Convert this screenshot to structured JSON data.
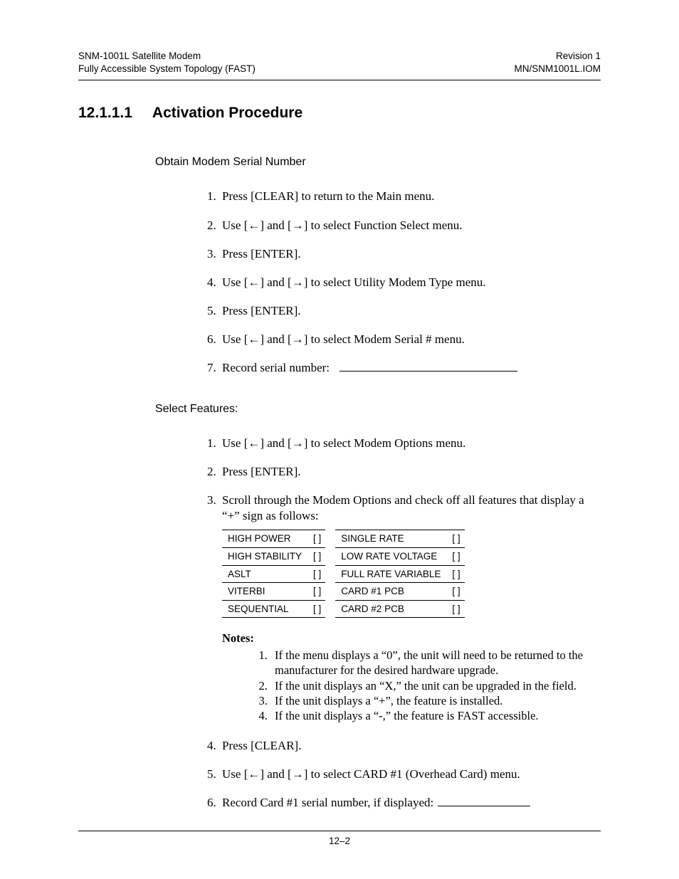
{
  "header": {
    "leftLine1": "SNM-1001L  Satellite Modem",
    "leftLine2": "Fully Accessible System Topology (FAST)",
    "rightLine1": "Revision 1",
    "rightLine2": "MN/SNM1001L.IOM"
  },
  "section": {
    "number": "12.1.1.1",
    "title": "Activation Procedure"
  },
  "sub1": {
    "heading": "Obtain Modem Serial Number",
    "steps": [
      "Press [CLEAR] to return to the Main menu.",
      "Use [←] and [→] to select Function Select menu.",
      "Press [ENTER].",
      "Use [←] and [→] to select Utility Modem Type menu.",
      "Press [ENTER].",
      "Use [←] and [→] to select Modem Serial # menu.",
      "Record serial number:"
    ]
  },
  "sub2": {
    "heading": "Select Features:",
    "steps": [
      "Use [←] and [→] to select Modem Options menu.",
      "Press [ENTER].",
      "Scroll through the Modem Options and check off all features that display a “+” sign as follows:",
      "Press [CLEAR].",
      "Use [←] and [→] to select CARD #1 (Overhead Card) menu.",
      "Record Card #1 serial number, if displayed:"
    ]
  },
  "features": {
    "box": "[  ]",
    "col1": [
      "HIGH POWER",
      "HIGH STABILITY",
      "ASLT",
      "VITERBI",
      "SEQUENTIAL"
    ],
    "col2": [
      "SINGLE RATE",
      "LOW RATE VOLTAGE",
      "FULL RATE VARIABLE",
      "CARD #1 PCB",
      "CARD #2 PCB"
    ]
  },
  "notes": {
    "title": "Notes:",
    "items": [
      "If the menu displays a “0”, the unit will need to be returned to the manufacturer for the desired hardware upgrade.",
      "If the unit displays an “X,” the unit can be upgraded in the field.",
      "If the unit displays a “+”, the feature is installed.",
      "If the unit displays a “-,” the feature is FAST accessible."
    ]
  },
  "footer": {
    "pageNum": "12–2"
  }
}
